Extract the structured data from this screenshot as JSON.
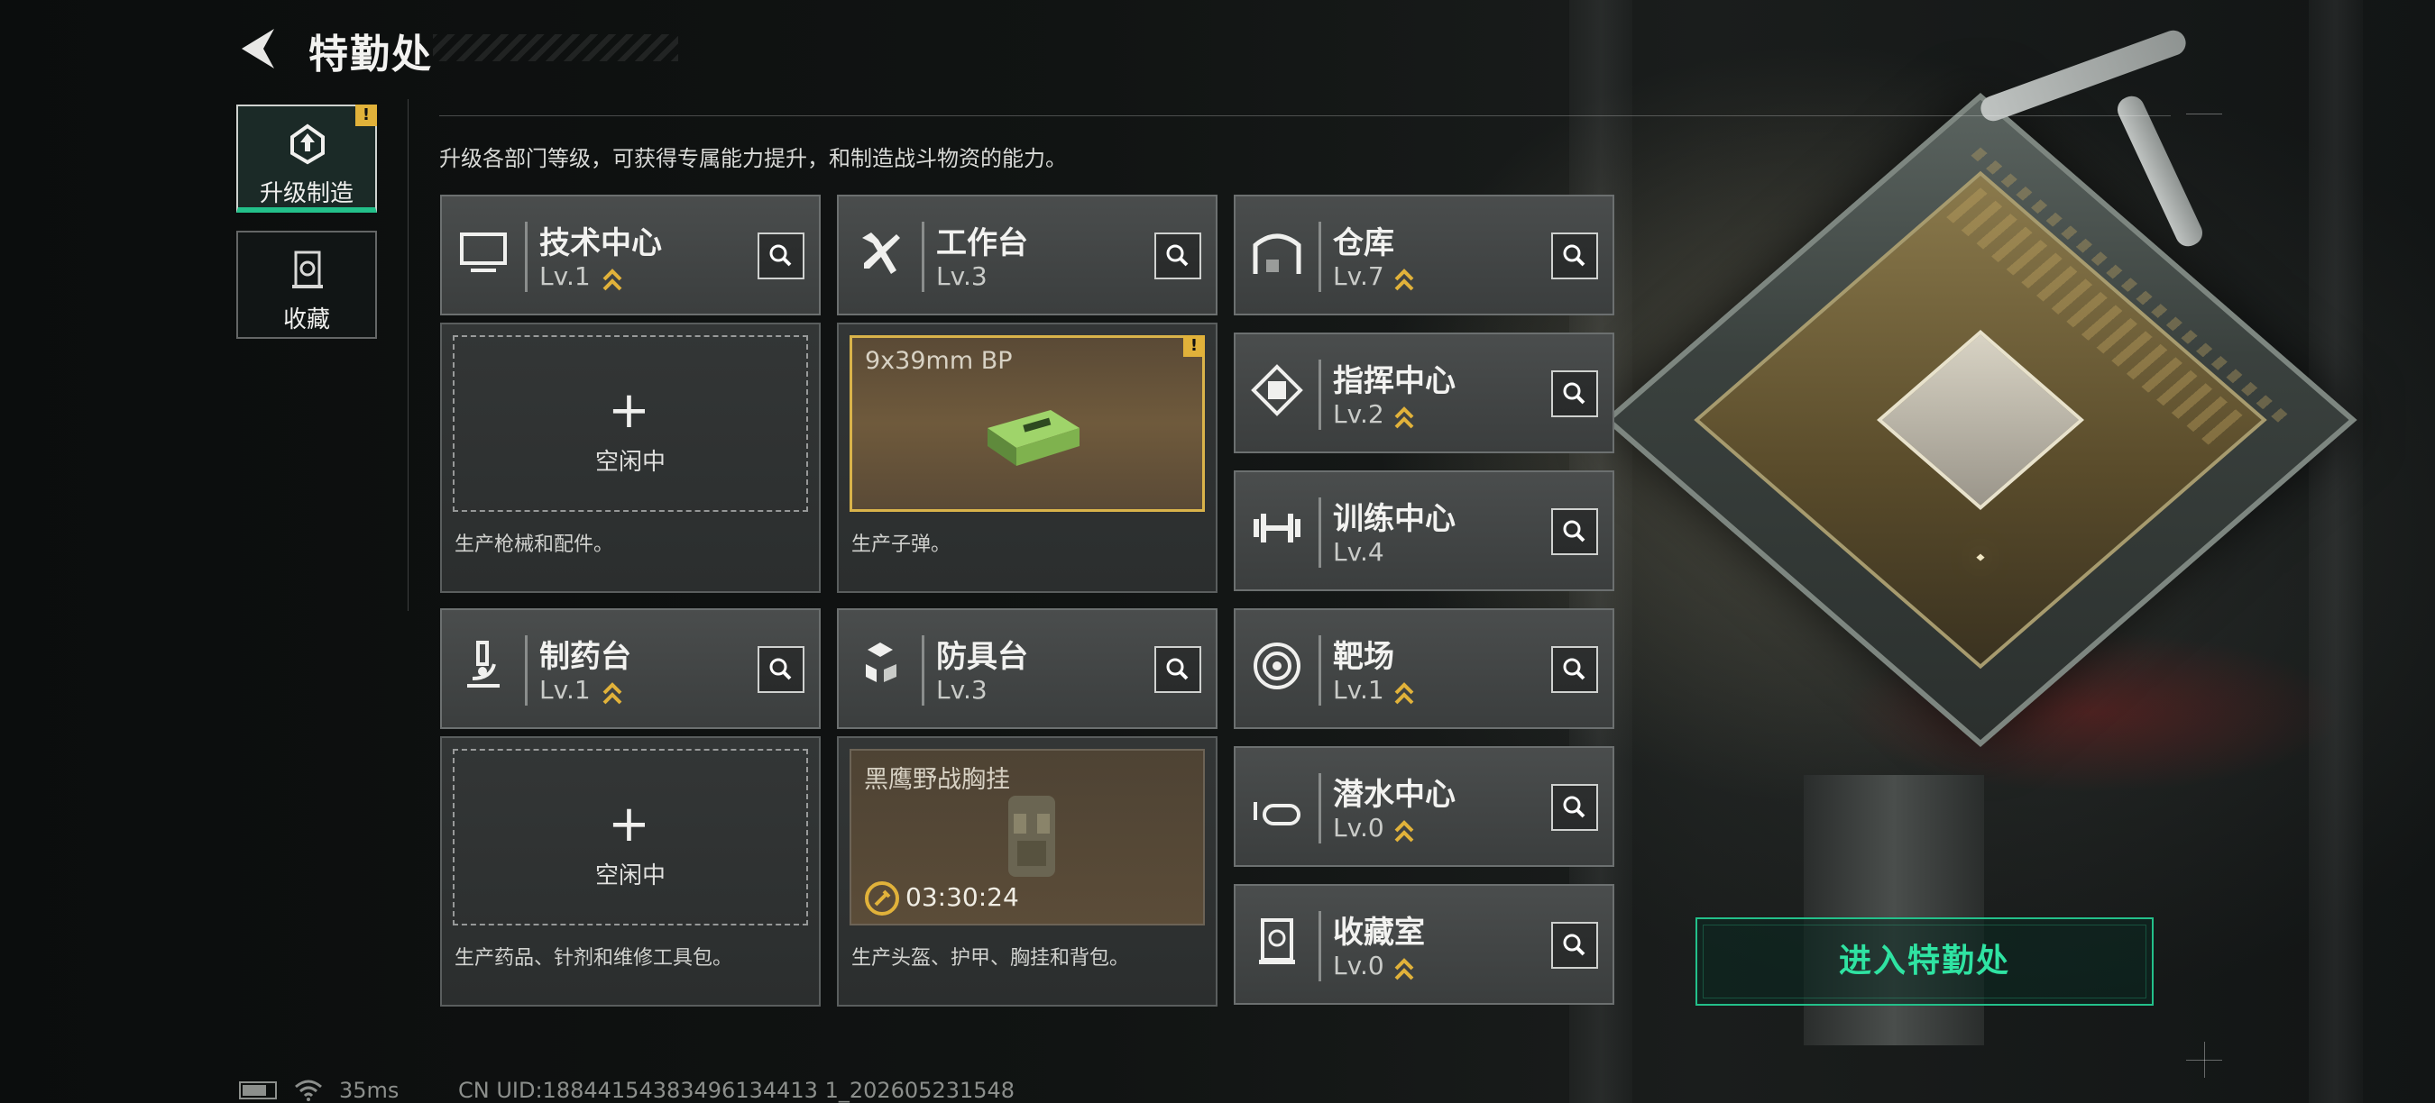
{
  "header": {
    "title": "特勤处"
  },
  "sidebar": {
    "tabs": [
      {
        "label": "升级制造",
        "active": true,
        "warn": "!"
      },
      {
        "label": "收藏",
        "active": false
      }
    ]
  },
  "description": "升级各部门等级，可获得专属能力提升，和制造战斗物资的能力。",
  "facilities": [
    {
      "name": "技术中心",
      "level": "Lv.1",
      "upgradable": true,
      "icon": "monitor-icon"
    },
    {
      "name": "工作台",
      "level": "Lv.3",
      "upgradable": false,
      "icon": "tools-icon"
    },
    {
      "name": "仓库",
      "level": "Lv.7",
      "upgradable": true,
      "icon": "warehouse-icon"
    },
    {
      "name": "指挥中心",
      "level": "Lv.2",
      "upgradable": true,
      "icon": "chip-icon"
    },
    {
      "name": "训练中心",
      "level": "Lv.4",
      "upgradable": false,
      "icon": "dumbbell-icon"
    },
    {
      "name": "制药台",
      "level": "Lv.1",
      "upgradable": true,
      "icon": "microscope-icon"
    },
    {
      "name": "防具台",
      "level": "Lv.3",
      "upgradable": false,
      "icon": "cubes-icon"
    },
    {
      "name": "靶场",
      "level": "Lv.1",
      "upgradable": true,
      "icon": "target-icon"
    },
    {
      "name": "潜水中心",
      "level": "Lv.0",
      "upgradable": true,
      "icon": "diving-mask-icon"
    },
    {
      "name": "收藏室",
      "level": "Lv.0",
      "upgradable": true,
      "icon": "trophy-case-icon"
    }
  ],
  "production": {
    "tech": {
      "status": "空闲中",
      "desc": "生产枪械和配件。"
    },
    "workbench": {
      "item": "9x39mm BP",
      "warn": "!",
      "desc": "生产子弹。"
    },
    "pharmacy": {
      "status": "空闲中",
      "desc": "生产药品、针剂和维修工具包。"
    },
    "armor": {
      "item": "黑鹰野战胸挂",
      "timer": "03:30:24",
      "desc": "生产头盔、护甲、胸挂和背包。"
    }
  },
  "enter_button": "进入特勤处",
  "status_bar": {
    "ping": "35ms",
    "uid": "CN UID:18844154383496134413 1_202605231548"
  },
  "colors": {
    "accent": "#23c08a",
    "warning": "#e1b23a",
    "upgrade": "#e1b23a"
  }
}
